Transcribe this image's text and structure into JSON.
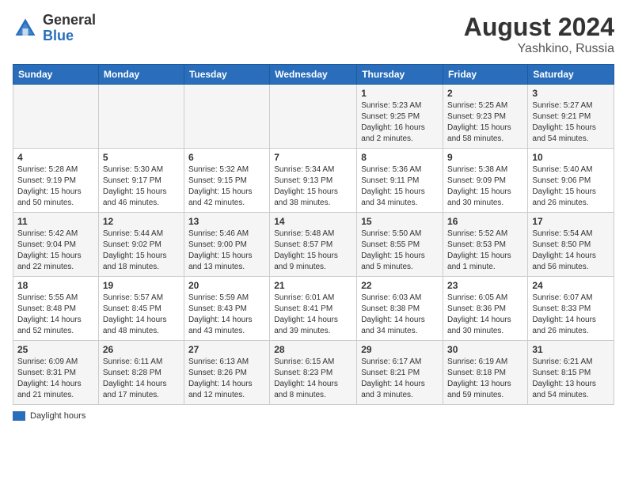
{
  "header": {
    "logo_general": "General",
    "logo_blue": "Blue",
    "month_year": "August 2024",
    "location": "Yashkino, Russia"
  },
  "days_of_week": [
    "Sunday",
    "Monday",
    "Tuesday",
    "Wednesday",
    "Thursday",
    "Friday",
    "Saturday"
  ],
  "legend_label": "Daylight hours",
  "weeks": [
    [
      {
        "day": "",
        "info": ""
      },
      {
        "day": "",
        "info": ""
      },
      {
        "day": "",
        "info": ""
      },
      {
        "day": "",
        "info": ""
      },
      {
        "day": "1",
        "info": "Sunrise: 5:23 AM\nSunset: 9:25 PM\nDaylight: 16 hours and 2 minutes."
      },
      {
        "day": "2",
        "info": "Sunrise: 5:25 AM\nSunset: 9:23 PM\nDaylight: 15 hours and 58 minutes."
      },
      {
        "day": "3",
        "info": "Sunrise: 5:27 AM\nSunset: 9:21 PM\nDaylight: 15 hours and 54 minutes."
      }
    ],
    [
      {
        "day": "4",
        "info": "Sunrise: 5:28 AM\nSunset: 9:19 PM\nDaylight: 15 hours and 50 minutes."
      },
      {
        "day": "5",
        "info": "Sunrise: 5:30 AM\nSunset: 9:17 PM\nDaylight: 15 hours and 46 minutes."
      },
      {
        "day": "6",
        "info": "Sunrise: 5:32 AM\nSunset: 9:15 PM\nDaylight: 15 hours and 42 minutes."
      },
      {
        "day": "7",
        "info": "Sunrise: 5:34 AM\nSunset: 9:13 PM\nDaylight: 15 hours and 38 minutes."
      },
      {
        "day": "8",
        "info": "Sunrise: 5:36 AM\nSunset: 9:11 PM\nDaylight: 15 hours and 34 minutes."
      },
      {
        "day": "9",
        "info": "Sunrise: 5:38 AM\nSunset: 9:09 PM\nDaylight: 15 hours and 30 minutes."
      },
      {
        "day": "10",
        "info": "Sunrise: 5:40 AM\nSunset: 9:06 PM\nDaylight: 15 hours and 26 minutes."
      }
    ],
    [
      {
        "day": "11",
        "info": "Sunrise: 5:42 AM\nSunset: 9:04 PM\nDaylight: 15 hours and 22 minutes."
      },
      {
        "day": "12",
        "info": "Sunrise: 5:44 AM\nSunset: 9:02 PM\nDaylight: 15 hours and 18 minutes."
      },
      {
        "day": "13",
        "info": "Sunrise: 5:46 AM\nSunset: 9:00 PM\nDaylight: 15 hours and 13 minutes."
      },
      {
        "day": "14",
        "info": "Sunrise: 5:48 AM\nSunset: 8:57 PM\nDaylight: 15 hours and 9 minutes."
      },
      {
        "day": "15",
        "info": "Sunrise: 5:50 AM\nSunset: 8:55 PM\nDaylight: 15 hours and 5 minutes."
      },
      {
        "day": "16",
        "info": "Sunrise: 5:52 AM\nSunset: 8:53 PM\nDaylight: 15 hours and 1 minute."
      },
      {
        "day": "17",
        "info": "Sunrise: 5:54 AM\nSunset: 8:50 PM\nDaylight: 14 hours and 56 minutes."
      }
    ],
    [
      {
        "day": "18",
        "info": "Sunrise: 5:55 AM\nSunset: 8:48 PM\nDaylight: 14 hours and 52 minutes."
      },
      {
        "day": "19",
        "info": "Sunrise: 5:57 AM\nSunset: 8:45 PM\nDaylight: 14 hours and 48 minutes."
      },
      {
        "day": "20",
        "info": "Sunrise: 5:59 AM\nSunset: 8:43 PM\nDaylight: 14 hours and 43 minutes."
      },
      {
        "day": "21",
        "info": "Sunrise: 6:01 AM\nSunset: 8:41 PM\nDaylight: 14 hours and 39 minutes."
      },
      {
        "day": "22",
        "info": "Sunrise: 6:03 AM\nSunset: 8:38 PM\nDaylight: 14 hours and 34 minutes."
      },
      {
        "day": "23",
        "info": "Sunrise: 6:05 AM\nSunset: 8:36 PM\nDaylight: 14 hours and 30 minutes."
      },
      {
        "day": "24",
        "info": "Sunrise: 6:07 AM\nSunset: 8:33 PM\nDaylight: 14 hours and 26 minutes."
      }
    ],
    [
      {
        "day": "25",
        "info": "Sunrise: 6:09 AM\nSunset: 8:31 PM\nDaylight: 14 hours and 21 minutes."
      },
      {
        "day": "26",
        "info": "Sunrise: 6:11 AM\nSunset: 8:28 PM\nDaylight: 14 hours and 17 minutes."
      },
      {
        "day": "27",
        "info": "Sunrise: 6:13 AM\nSunset: 8:26 PM\nDaylight: 14 hours and 12 minutes."
      },
      {
        "day": "28",
        "info": "Sunrise: 6:15 AM\nSunset: 8:23 PM\nDaylight: 14 hours and 8 minutes."
      },
      {
        "day": "29",
        "info": "Sunrise: 6:17 AM\nSunset: 8:21 PM\nDaylight: 14 hours and 3 minutes."
      },
      {
        "day": "30",
        "info": "Sunrise: 6:19 AM\nSunset: 8:18 PM\nDaylight: 13 hours and 59 minutes."
      },
      {
        "day": "31",
        "info": "Sunrise: 6:21 AM\nSunset: 8:15 PM\nDaylight: 13 hours and 54 minutes."
      }
    ]
  ]
}
